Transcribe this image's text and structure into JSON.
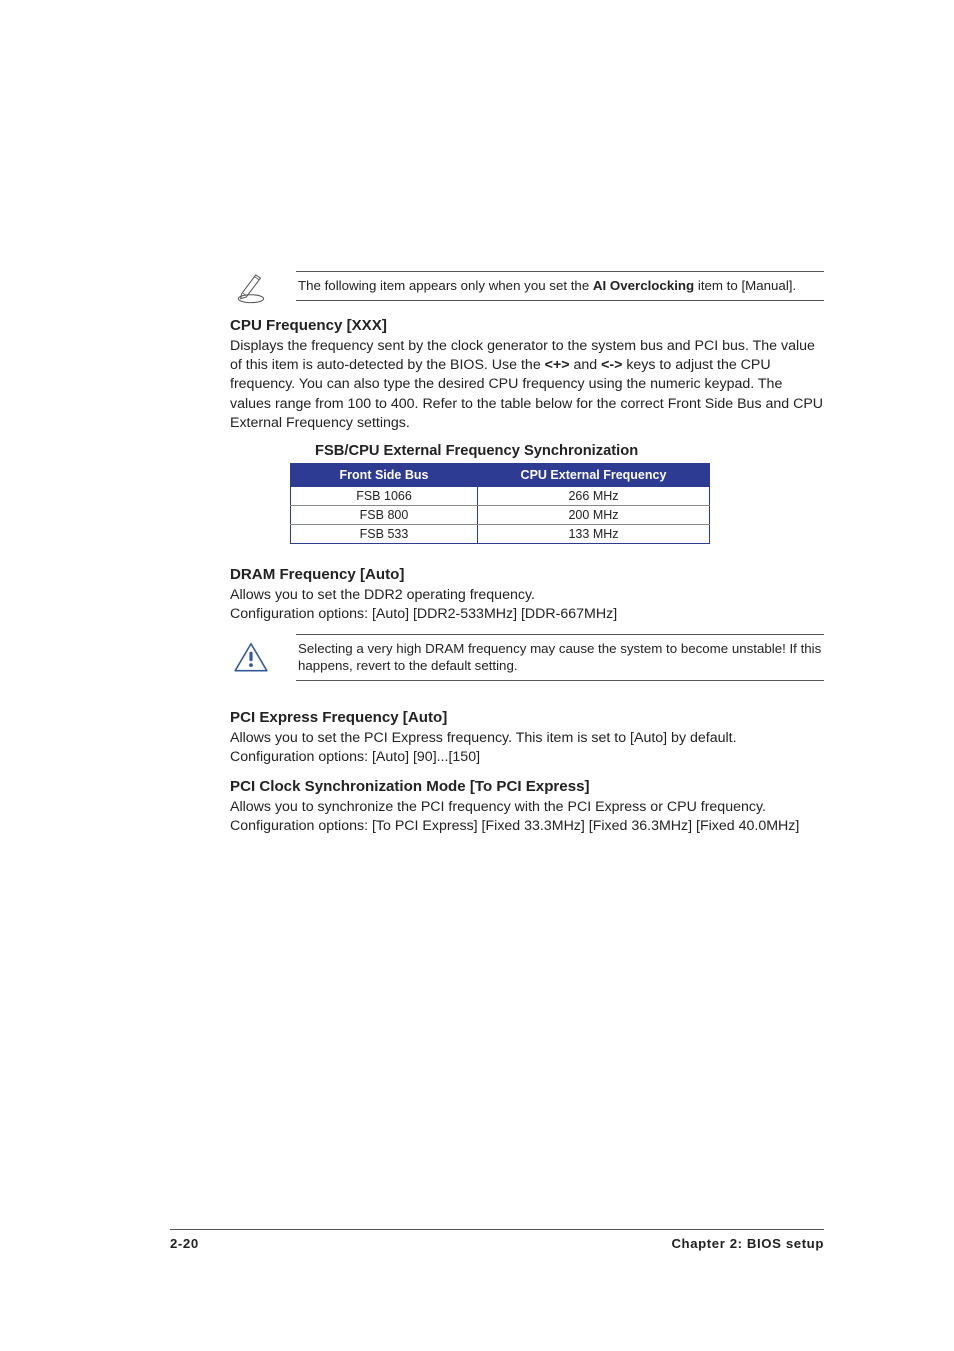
{
  "note1": {
    "pre_text": "The following item appears only when you set the ",
    "bold": "AI Overclocking",
    "post_text": " item to [Manual]."
  },
  "cpu_freq": {
    "heading": "CPU Frequency [XXX]",
    "body_pre": "Displays the frequency sent by the clock generator to the system bus and PCI bus. The value of this item is auto-detected by the BIOS. Use the ",
    "plus_key": "<+>",
    "mid1": " and ",
    "minus_key": "<->",
    "body_post": " keys to adjust the CPU frequency. You can also type the desired CPU frequency using the numeric keypad. The values range from 100 to 400. Refer to the table below for the correct Front Side Bus and CPU External Frequency settings."
  },
  "fsb_table": {
    "title": "FSB/CPU External Frequency Synchronization",
    "headers": {
      "fsb": "Front Side Bus",
      "cpu": "CPU External Frequency"
    },
    "rows": [
      {
        "fsb": "FSB 1066",
        "cpu": "266 MHz"
      },
      {
        "fsb": "FSB 800",
        "cpu": "200 MHz"
      },
      {
        "fsb": "FSB 533",
        "cpu": "133 MHz"
      }
    ]
  },
  "dram": {
    "heading": "DRAM Frequency [Auto]",
    "line1": "Allows you to set the DDR2 operating frequency.",
    "line2": "Configuration options: [Auto] [DDR2-533MHz] [DDR-667MHz]"
  },
  "note2": {
    "text": "Selecting a very high DRAM frequency may cause the system to become unstable! If this happens, revert to the default setting."
  },
  "pcie": {
    "heading": "PCI Express Frequency [Auto]",
    "body": "Allows you to set the PCI Express frequency. This item is set to [Auto] by default. Configuration options: [Auto] [90]...[150]"
  },
  "pci_clock": {
    "heading": "PCI Clock Synchronization Mode [To PCI Express]",
    "body": "Allows you to synchronize the PCI frequency with the PCI Express or CPU frequency. Configuration options: [To PCI Express] [Fixed 33.3MHz] [Fixed 36.3MHz] [Fixed 40.0MHz]"
  },
  "footer": {
    "left": "2-20",
    "right": "Chapter 2: BIOS setup"
  }
}
